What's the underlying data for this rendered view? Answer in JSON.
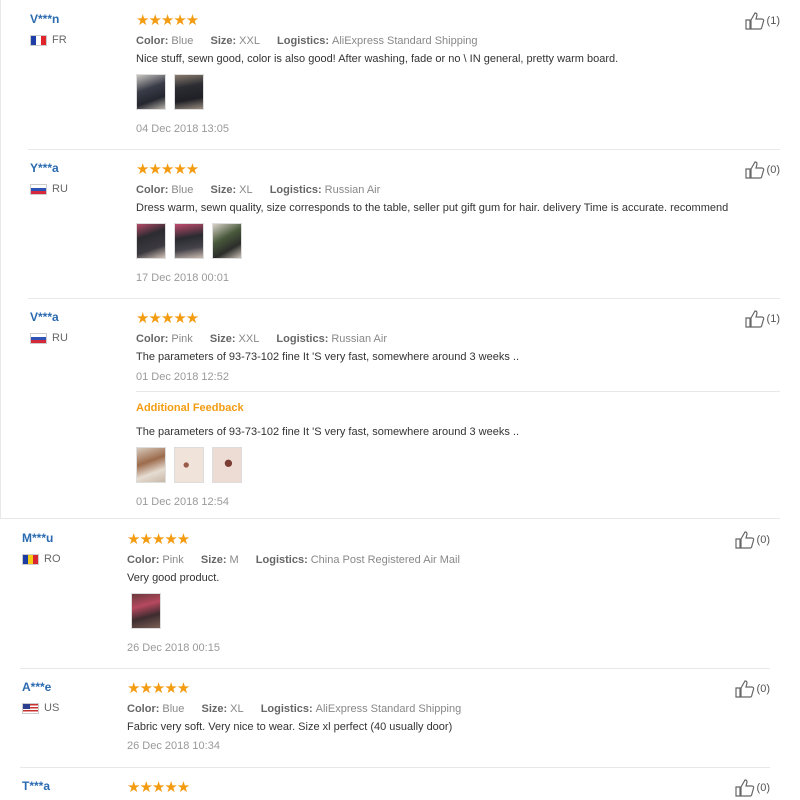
{
  "labels": {
    "color": "Color:",
    "size": "Size:",
    "logistics": "Logistics:",
    "additional_feedback": "Additional Feedback"
  },
  "reviews": [
    {
      "user": "V***n",
      "country": "FR",
      "stars": "★★★★★",
      "color": "Blue",
      "size": "XXL",
      "logistics": "AliExpress Standard Shipping",
      "text": "Nice stuff, sewn good, color is also good! After washing, fade or no \\ IN general, pretty warm board.",
      "date": "04 Dec 2018 13:05",
      "likes": "(1)",
      "photo_count": 2
    },
    {
      "user": "Y***a",
      "country": "RU",
      "stars": "★★★★★",
      "color": "Blue",
      "size": "XL",
      "logistics": "Russian Air",
      "text": "Dress warm, sewn quality, size corresponds to the table, seller put gift gum for hair. delivery Time is accurate. recommend",
      "date": "17 Dec 2018 00:01",
      "likes": "(0)",
      "photo_count": 3
    },
    {
      "user": "V***a",
      "country": "RU",
      "stars": "★★★★★",
      "color": "Pink",
      "size": "XXL",
      "logistics": "Russian Air",
      "text": "The parameters of 93-73-102 fine It 'S very fast, somewhere around 3 weeks ..",
      "date": "01 Dec 2018 12:52",
      "likes": "(1)",
      "additional": {
        "text": "The parameters of 93-73-102 fine It 'S very fast, somewhere around 3 weeks ..",
        "date": "01 Dec 2018 12:54",
        "photo_count": 3
      }
    },
    {
      "user": "M***u",
      "country": "RO",
      "stars": "★★★★★",
      "color": "Pink",
      "size": "M",
      "logistics": "China Post Registered Air Mail",
      "text": "Very good product.",
      "date": "26 Dec 2018 00:15",
      "likes": "(0)",
      "photo_count": 1
    },
    {
      "user": "A***e",
      "country": "US",
      "stars": "★★★★★",
      "color": "Blue",
      "size": "XL",
      "logistics": "AliExpress Standard Shipping",
      "text": "Fabric very soft. Very nice to wear. Size xl perfect (40 usually door)",
      "date": "26 Dec 2018 10:34",
      "likes": "(0)"
    },
    {
      "user": "T***a",
      "stars": "★★★★★",
      "likes": "(0)"
    }
  ]
}
